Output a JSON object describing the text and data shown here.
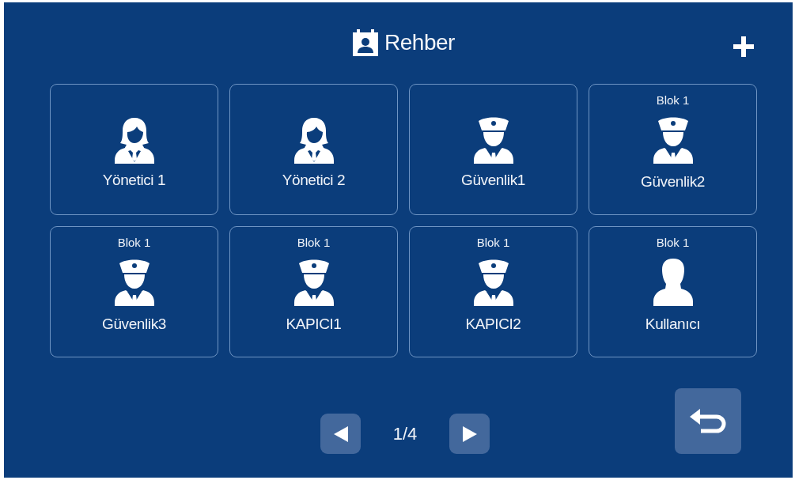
{
  "title": "Rehber",
  "contacts": [
    {
      "kind": "woman",
      "name": "Yönetici 1"
    },
    {
      "kind": "woman",
      "name": "Yönetici 2"
    },
    {
      "kind": "guard",
      "name": "Güvenlik1"
    },
    {
      "kind": "guard",
      "block": "Blok 1",
      "name": "Güvenlik2"
    },
    {
      "kind": "guard",
      "block": "Blok 1",
      "name": "Güvenlik3"
    },
    {
      "kind": "guard",
      "block": "Blok 1",
      "name": "KAPICI1"
    },
    {
      "kind": "guard",
      "block": "Blok 1",
      "name": "KAPICI2"
    },
    {
      "kind": "user",
      "block": "Blok 1",
      "name": "Kullanıcı"
    }
  ],
  "pagination": {
    "page": "1/4"
  }
}
